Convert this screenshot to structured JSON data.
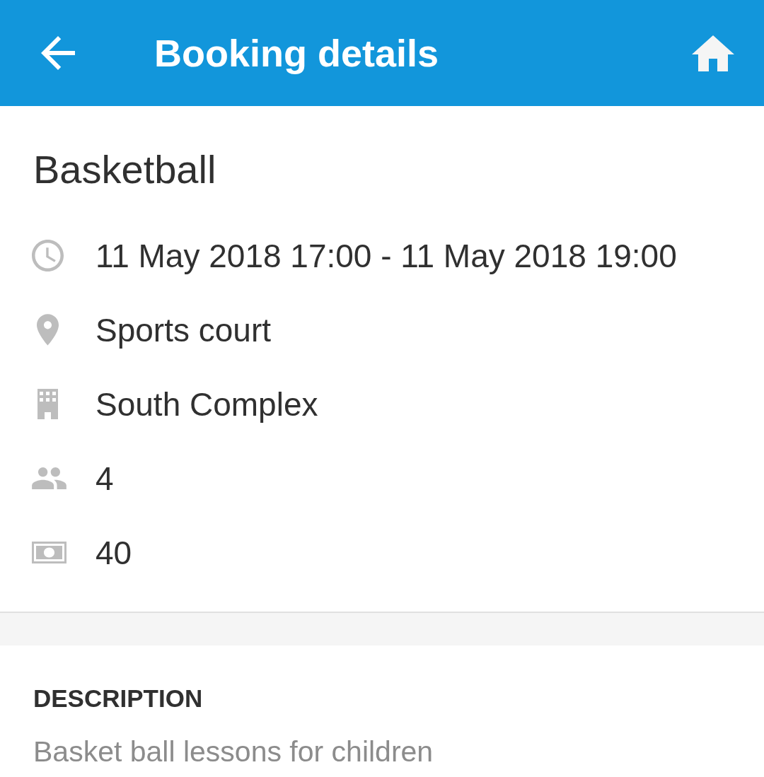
{
  "app_bar": {
    "title": "Booking details"
  },
  "booking": {
    "title": "Basketball",
    "details": [
      {
        "kind": "time",
        "text": "11 May 2018 17:00 - 11 May 2018 19:00"
      },
      {
        "kind": "location",
        "text": "Sports court"
      },
      {
        "kind": "building",
        "text": "South Complex"
      },
      {
        "kind": "people",
        "text": "4"
      },
      {
        "kind": "price",
        "text": "40"
      }
    ]
  },
  "description": {
    "heading": "DESCRIPTION",
    "text": "Basket ball lessons for children"
  }
}
